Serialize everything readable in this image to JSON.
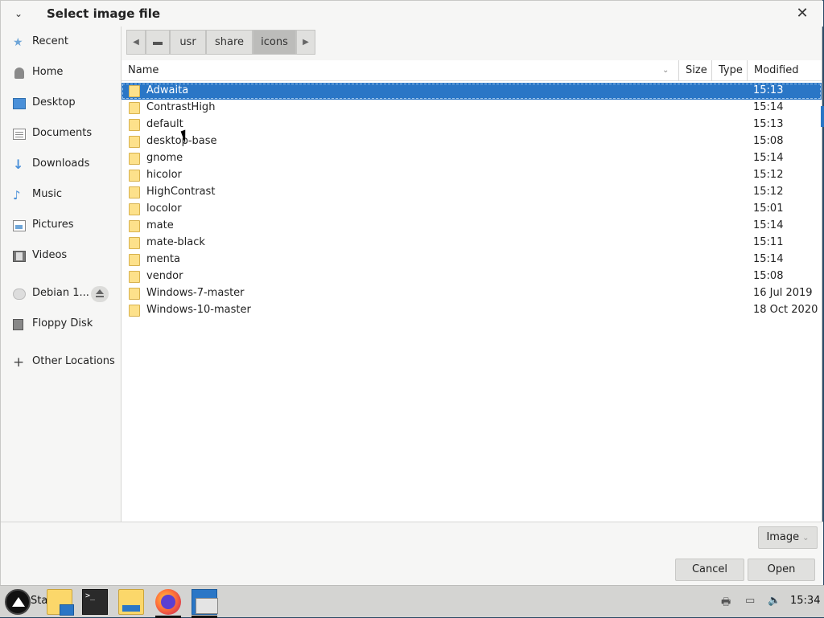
{
  "dialog": {
    "title": "Select image file",
    "menu_glyph": "⌄",
    "close_glyph": "✕"
  },
  "sidebar": {
    "items": [
      {
        "label": "Recent",
        "icon": "recent-icon"
      },
      {
        "label": "Home",
        "icon": "home-icon"
      },
      {
        "label": "Desktop",
        "icon": "desktop-icon"
      },
      {
        "label": "Documents",
        "icon": "documents-icon"
      },
      {
        "label": "Downloads",
        "icon": "downloads-icon"
      },
      {
        "label": "Music",
        "icon": "music-icon"
      },
      {
        "label": "Pictures",
        "icon": "pictures-icon"
      },
      {
        "label": "Videos",
        "icon": "videos-icon"
      }
    ],
    "devices": [
      {
        "label": "Debian 1...",
        "icon": "disk-icon"
      },
      {
        "label": "Floppy Disk",
        "icon": "floppy-icon"
      }
    ],
    "other": {
      "label": "Other Locations",
      "icon": "plus-icon"
    }
  },
  "pathbar": {
    "segments": [
      "usr",
      "share",
      "icons"
    ],
    "active": "icons"
  },
  "columns": {
    "name": "Name",
    "size": "Size",
    "type": "Type",
    "modified": "Modified"
  },
  "files": [
    {
      "name": "Adwaita",
      "modified": "15:13",
      "selected": true
    },
    {
      "name": "ContrastHigh",
      "modified": "15:14"
    },
    {
      "name": "default",
      "modified": "15:13"
    },
    {
      "name": "desktop-base",
      "modified": "15:08"
    },
    {
      "name": "gnome",
      "modified": "15:14"
    },
    {
      "name": "hicolor",
      "modified": "15:12"
    },
    {
      "name": "HighContrast",
      "modified": "15:12"
    },
    {
      "name": "locolor",
      "modified": "15:01"
    },
    {
      "name": "mate",
      "modified": "15:14"
    },
    {
      "name": "mate-black",
      "modified": "15:11"
    },
    {
      "name": "menta",
      "modified": "15:14"
    },
    {
      "name": "vendor",
      "modified": "15:08"
    },
    {
      "name": "Windows-7-master",
      "modified": "16 Jul 2019"
    },
    {
      "name": "Windows-10-master",
      "modified": "18 Oct 2020"
    }
  ],
  "footer": {
    "filter": "Image",
    "cancel": "Cancel",
    "open": "Open"
  },
  "taskbar": {
    "start_label": "Sta",
    "clock": "15:34"
  },
  "colors": {
    "selection": "#2a76c6",
    "folder": "#fde18b"
  }
}
